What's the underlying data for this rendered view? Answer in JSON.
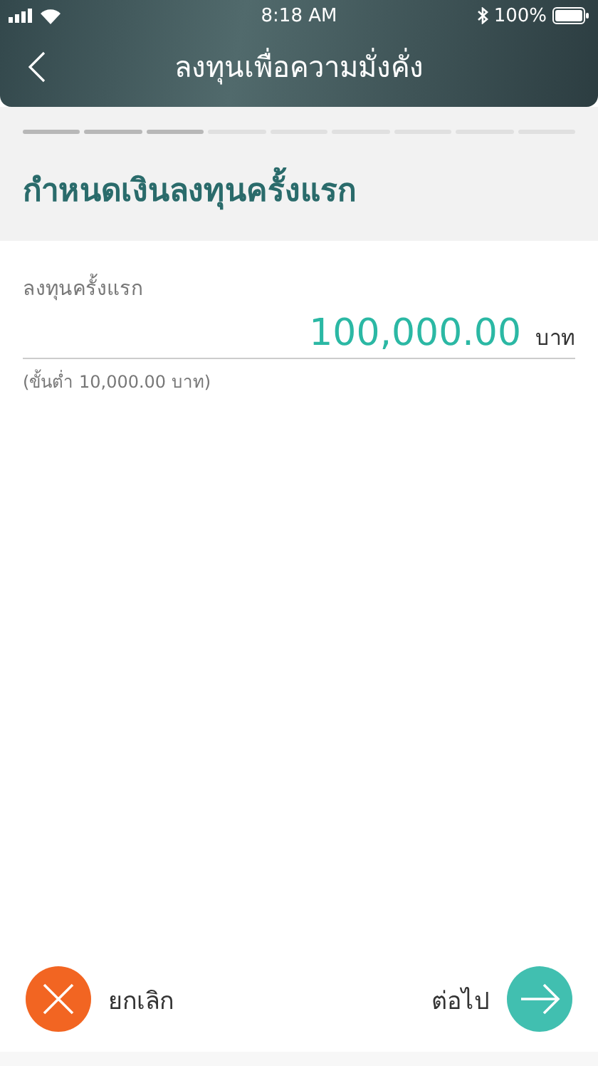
{
  "status_bar": {
    "time": "8:18 AM",
    "battery": "100%"
  },
  "header": {
    "title": "ลงทุนเพื่อความมั่งคั่ง"
  },
  "steps": [
    {
      "done": true
    },
    {
      "done": true
    },
    {
      "done": true
    },
    {
      "done": false
    },
    {
      "done": false
    },
    {
      "done": false
    },
    {
      "done": false
    },
    {
      "done": false
    },
    {
      "done": false
    }
  ],
  "section_title": "กำหนดเงินลงทุนครั้งแรก",
  "amount_field": {
    "label": "ลงทุนครั้งแรก",
    "value": "100,000.00",
    "unit": "บาท",
    "hint": "(ขั้นต่ำ 10,000.00 บาท)"
  },
  "cancel_button": {
    "label": "ยกเลิก"
  },
  "next_button": {
    "label": "ต่อไป"
  }
}
